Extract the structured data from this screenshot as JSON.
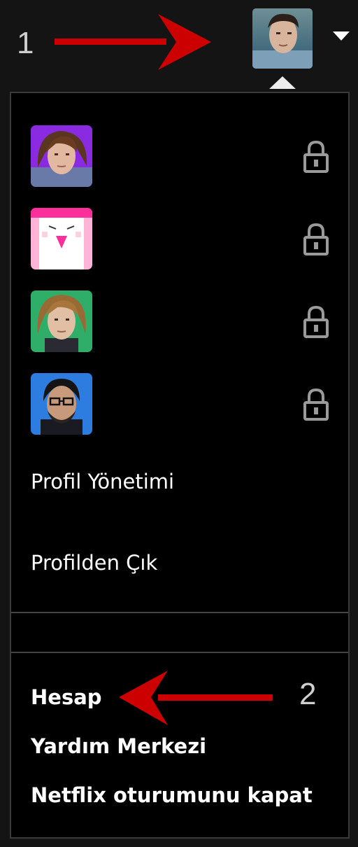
{
  "annotations": {
    "step1": "1",
    "step2": "2",
    "arrow_color": "#cc0000"
  },
  "header": {
    "current_profile_icon": "avatar-icon",
    "dropdown_icon": "caret-down-icon"
  },
  "profiles": [
    {
      "icon": "profile-avatar-icon",
      "locked": true,
      "lock_icon": "lock-icon"
    },
    {
      "icon": "profile-avatar-icon",
      "locked": true,
      "lock_icon": "lock-icon"
    },
    {
      "icon": "profile-avatar-icon",
      "locked": true,
      "lock_icon": "lock-icon"
    },
    {
      "icon": "profile-avatar-icon",
      "locked": true,
      "lock_icon": "lock-icon"
    }
  ],
  "menu": {
    "manage_profiles": "Profil Yönetimi",
    "exit_profile": "Profilden Çık"
  },
  "account_menu": {
    "account": "Hesap",
    "help_center": "Yardım Merkezi",
    "sign_out": "Netflix oturumunu kapat"
  },
  "colors": {
    "background": "#141414",
    "panel": "#000000",
    "divider": "#444444",
    "lock": "#9a9a9a"
  }
}
